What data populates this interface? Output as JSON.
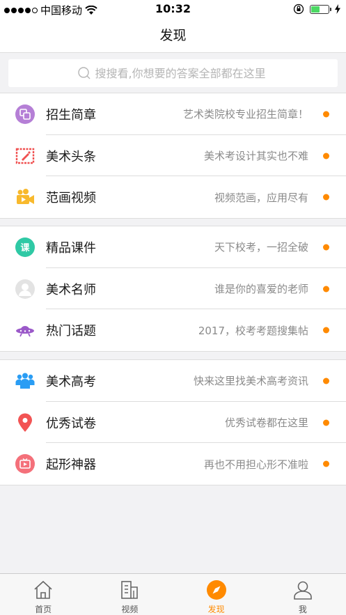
{
  "status_bar": {
    "carrier": "中国移动",
    "time": "10:32",
    "battery_level": 0.5
  },
  "nav": {
    "title": "发现"
  },
  "search": {
    "placeholder": "搜搜看,你想要的答案全部都在这里"
  },
  "groups": [
    {
      "items": [
        {
          "icon": "brochure-icon",
          "label": "招生简章",
          "desc": "艺术类院校专业招生简章！"
        },
        {
          "icon": "headline-icon",
          "label": "美术头条",
          "desc": "美术考设计其实也不难"
        },
        {
          "icon": "video-camera-icon",
          "label": "范画视频",
          "desc": "视频范画，应用尽有"
        }
      ]
    },
    {
      "items": [
        {
          "icon": "course-icon",
          "label": "精品课件",
          "desc": "天下校考，一招全破"
        },
        {
          "icon": "teacher-avatar-icon",
          "label": "美术名师",
          "desc": "谁是你的喜爱的老师"
        },
        {
          "icon": "ufo-icon",
          "label": "热门话题",
          "desc": "2017，校考考题搜集帖"
        }
      ]
    },
    {
      "items": [
        {
          "icon": "people-group-icon",
          "label": "美术高考",
          "desc": "快来这里找美术高考资讯"
        },
        {
          "icon": "location-pin-icon",
          "label": "优秀试卷",
          "desc": "优秀试卷都在这里"
        },
        {
          "icon": "tv-play-icon",
          "label": "起形神器",
          "desc": "再也不用担心形不准啦"
        }
      ]
    }
  ],
  "tabs": [
    {
      "icon": "home-icon",
      "label": "首页",
      "active": false
    },
    {
      "icon": "video-building-icon",
      "label": "视频",
      "active": false
    },
    {
      "icon": "compass-icon",
      "label": "发现",
      "active": true
    },
    {
      "icon": "user-icon",
      "label": "我",
      "active": false
    }
  ],
  "colors": {
    "accent": "#ff8a00",
    "brochure": "#b57fd6",
    "headline": "#f05050",
    "video": "#f8b92d",
    "course": "#2fc9a5",
    "ufo": "#9b59c9",
    "people": "#2a9df4",
    "pin": "#f25454",
    "tv": "#f4707a"
  }
}
